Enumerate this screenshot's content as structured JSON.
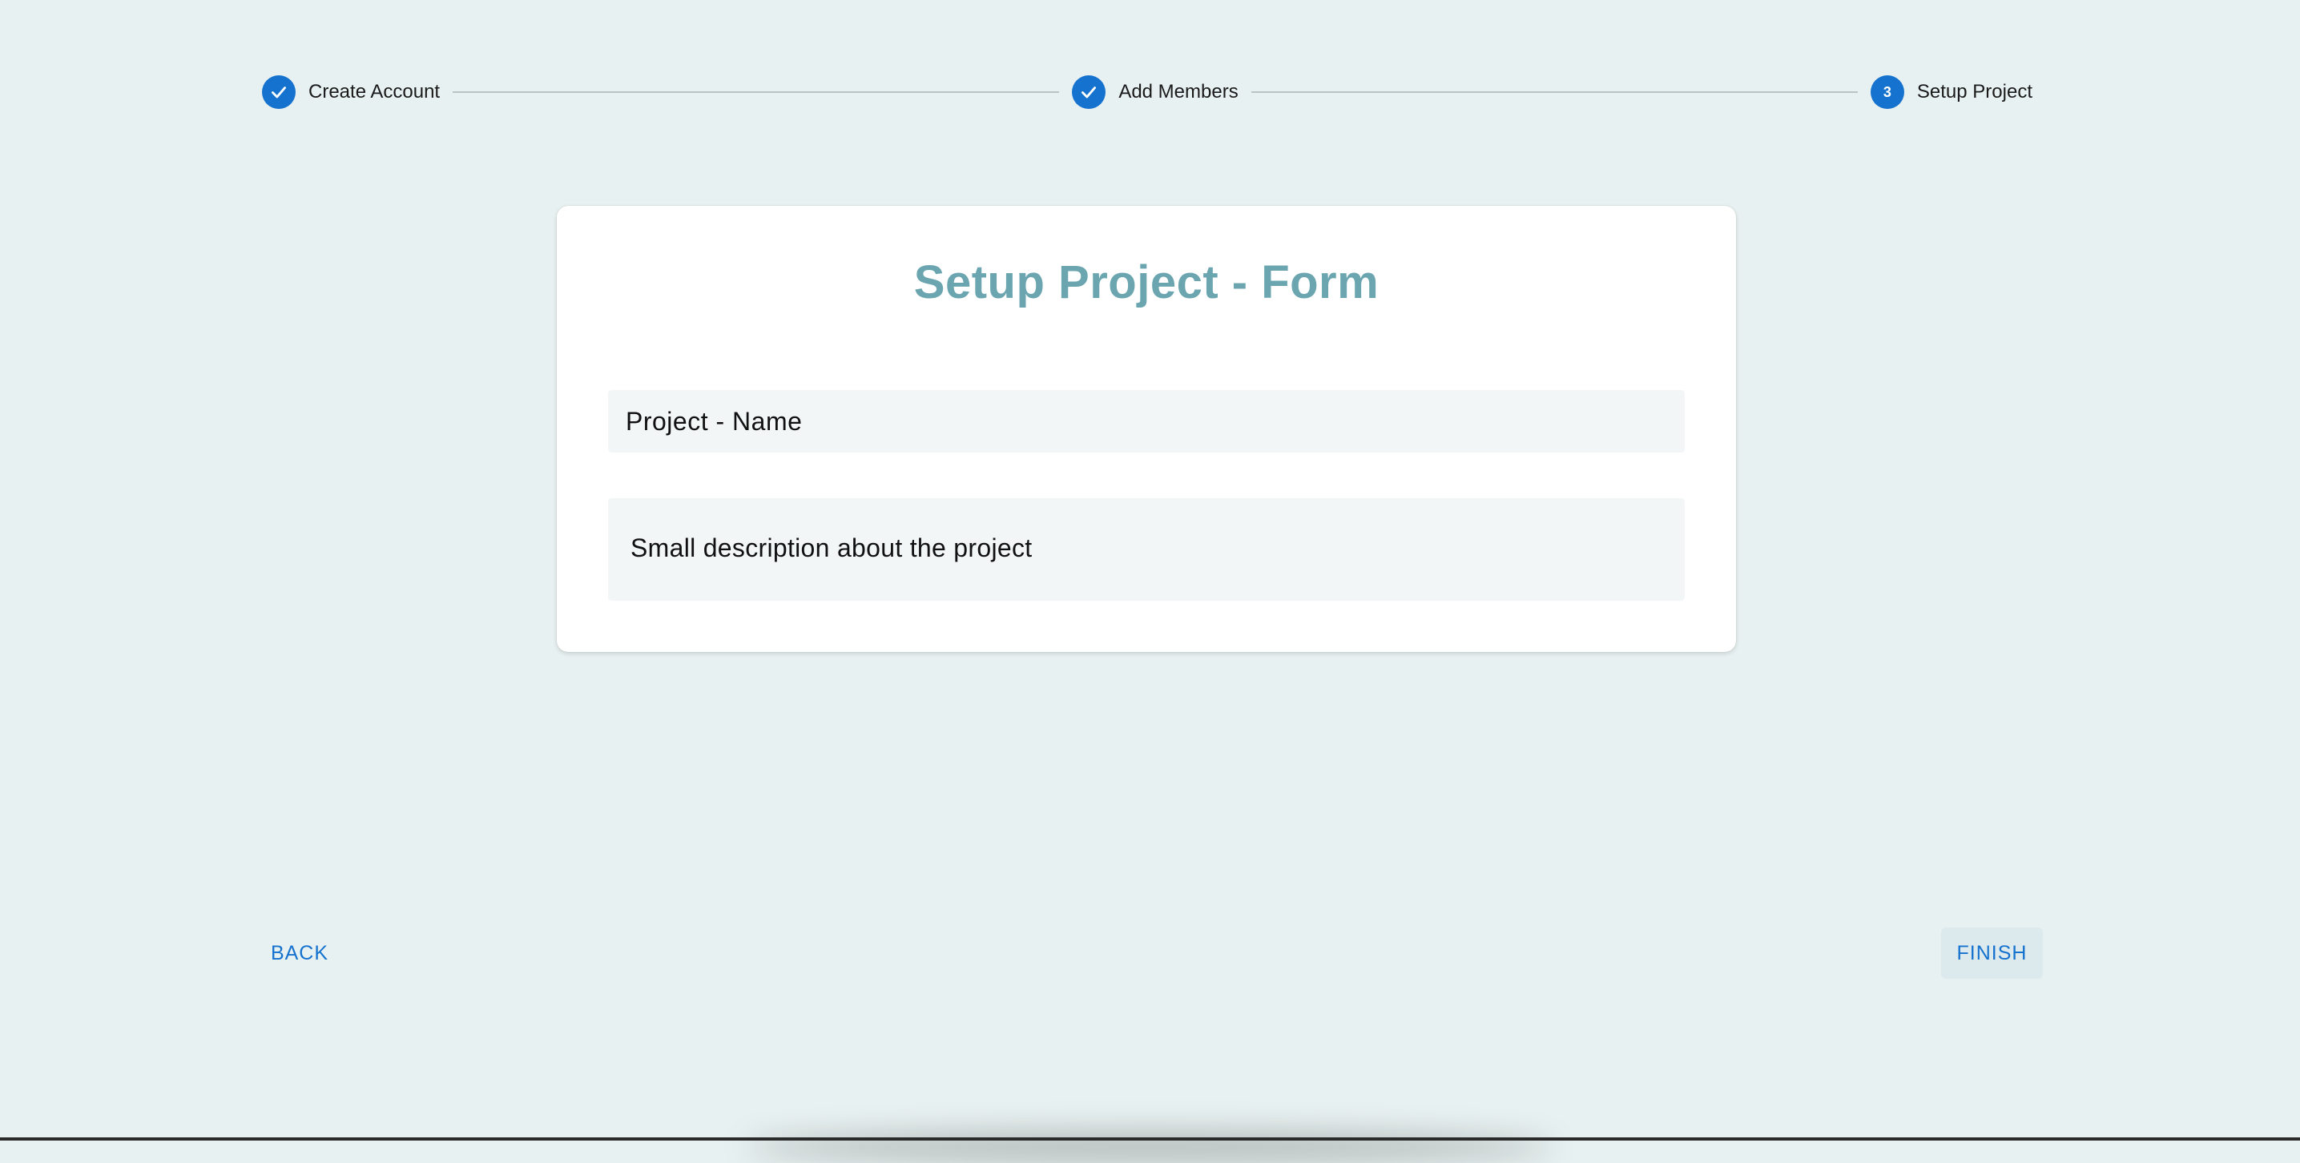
{
  "stepper": {
    "steps": [
      {
        "label": "Create Account",
        "state": "completed",
        "icon": "check-icon"
      },
      {
        "label": "Add Members",
        "state": "completed",
        "icon": "check-icon"
      },
      {
        "label": "Setup Project",
        "state": "active",
        "number": "3"
      }
    ],
    "accent_color": "#1572cf",
    "connector_color": "#b8c4c8"
  },
  "form": {
    "title": "Setup Project - Form",
    "title_color": "#6ba6b0",
    "project_name": {
      "placeholder": "Project - Name",
      "value": ""
    },
    "description": {
      "placeholder": "Small description about the project",
      "value": ""
    }
  },
  "actions": {
    "back_label": "BACK",
    "finish_label": "FINISH"
  },
  "colors": {
    "background": "#e8f1f1",
    "card": "#ffffff",
    "field_background": "#f3f6f7",
    "finish_button_background": "#dce9ed"
  }
}
